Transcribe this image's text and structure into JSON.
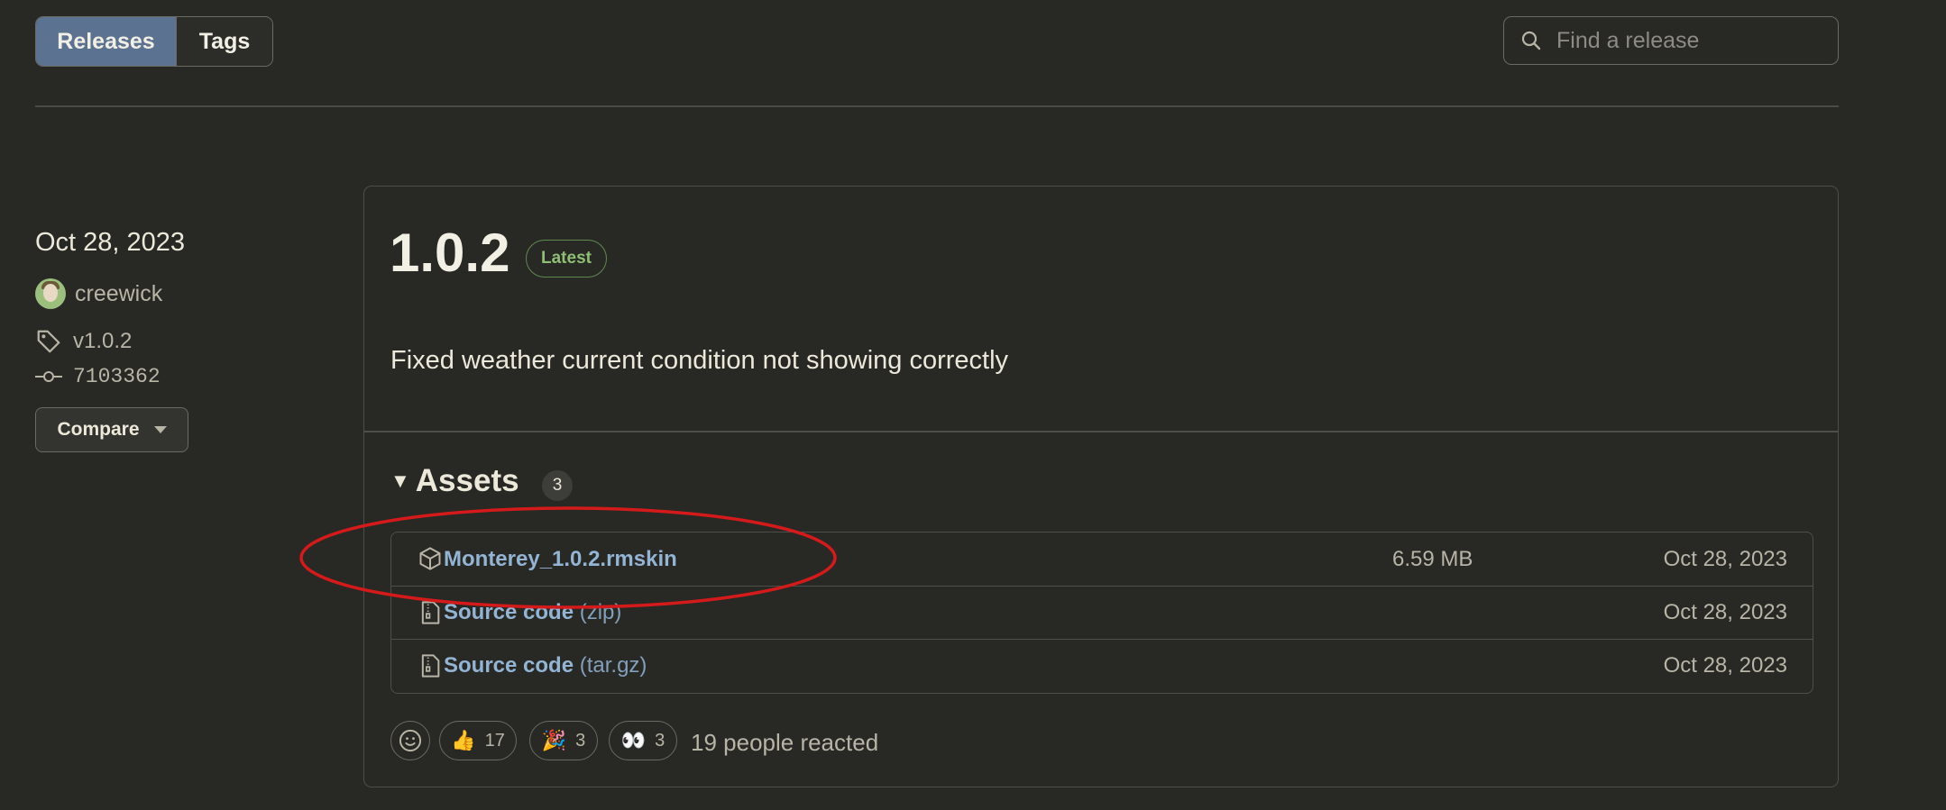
{
  "nav": {
    "tabs": [
      {
        "label": "Releases",
        "active": true
      },
      {
        "label": "Tags",
        "active": false
      }
    ],
    "search_placeholder": "Find a release"
  },
  "release": {
    "date": "Oct 28, 2023",
    "author": "creewick",
    "tag": "v1.0.2",
    "commit": "7103362",
    "compare_label": "Compare",
    "version": "1.0.2",
    "badge": "Latest",
    "notes": "Fixed weather current condition not showing correctly",
    "assets": {
      "title": "Assets",
      "count": "3",
      "items": [
        {
          "name": "Monterey_1.0.2.rmskin",
          "suffix": "",
          "size": "6.59 MB",
          "date": "Oct 28, 2023",
          "icon": "package-icon"
        },
        {
          "name": "Source code",
          "suffix": "(zip)",
          "size": "",
          "date": "Oct 28, 2023",
          "icon": "file-zip-icon"
        },
        {
          "name": "Source code",
          "suffix": "(tar.gz)",
          "size": "",
          "date": "Oct 28, 2023",
          "icon": "file-zip-icon"
        }
      ]
    },
    "reactions": [
      {
        "emoji": "👍",
        "count": "17"
      },
      {
        "emoji": "🎉",
        "count": "3"
      },
      {
        "emoji": "👀",
        "count": "3"
      }
    ],
    "reactions_summary": "19 people reacted"
  },
  "colors": {
    "background": "#282825",
    "accent_active_tab": "#5b7291",
    "link": "#93b4d3",
    "latest_badge": "#8fbf74",
    "annotation_ellipse": "#d41a1a"
  }
}
